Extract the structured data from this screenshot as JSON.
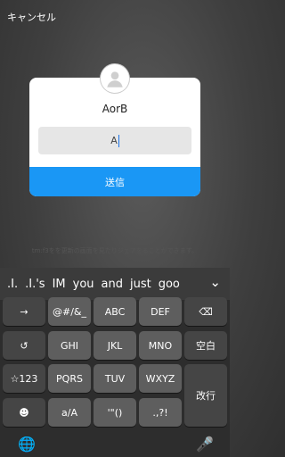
{
  "header": {
    "cancel": "キャンセル"
  },
  "dialog": {
    "title": "AorB",
    "input_value": "A",
    "send_label": "送信"
  },
  "note": "tm:f3をを更新の画面を見たりジェアをることができます。",
  "suggestions": [
    ".I.",
    ".I.'s",
    "IM",
    "you",
    "and",
    "just",
    "goo"
  ],
  "keys": {
    "r1": [
      "→",
      "@#/&_",
      "ABC",
      "DEF",
      "⌫"
    ],
    "r2": [
      "↺",
      "GHI",
      "JKL",
      "MNO",
      "空白"
    ],
    "r3": [
      "☆123",
      "PQRS",
      "TUV",
      "WXYZ",
      "改行"
    ],
    "r4": [
      "☻",
      "a/A",
      "'\"()",
      ".,?!"
    ]
  },
  "bottom": {
    "globe": "🌐",
    "mic": "🎤"
  }
}
